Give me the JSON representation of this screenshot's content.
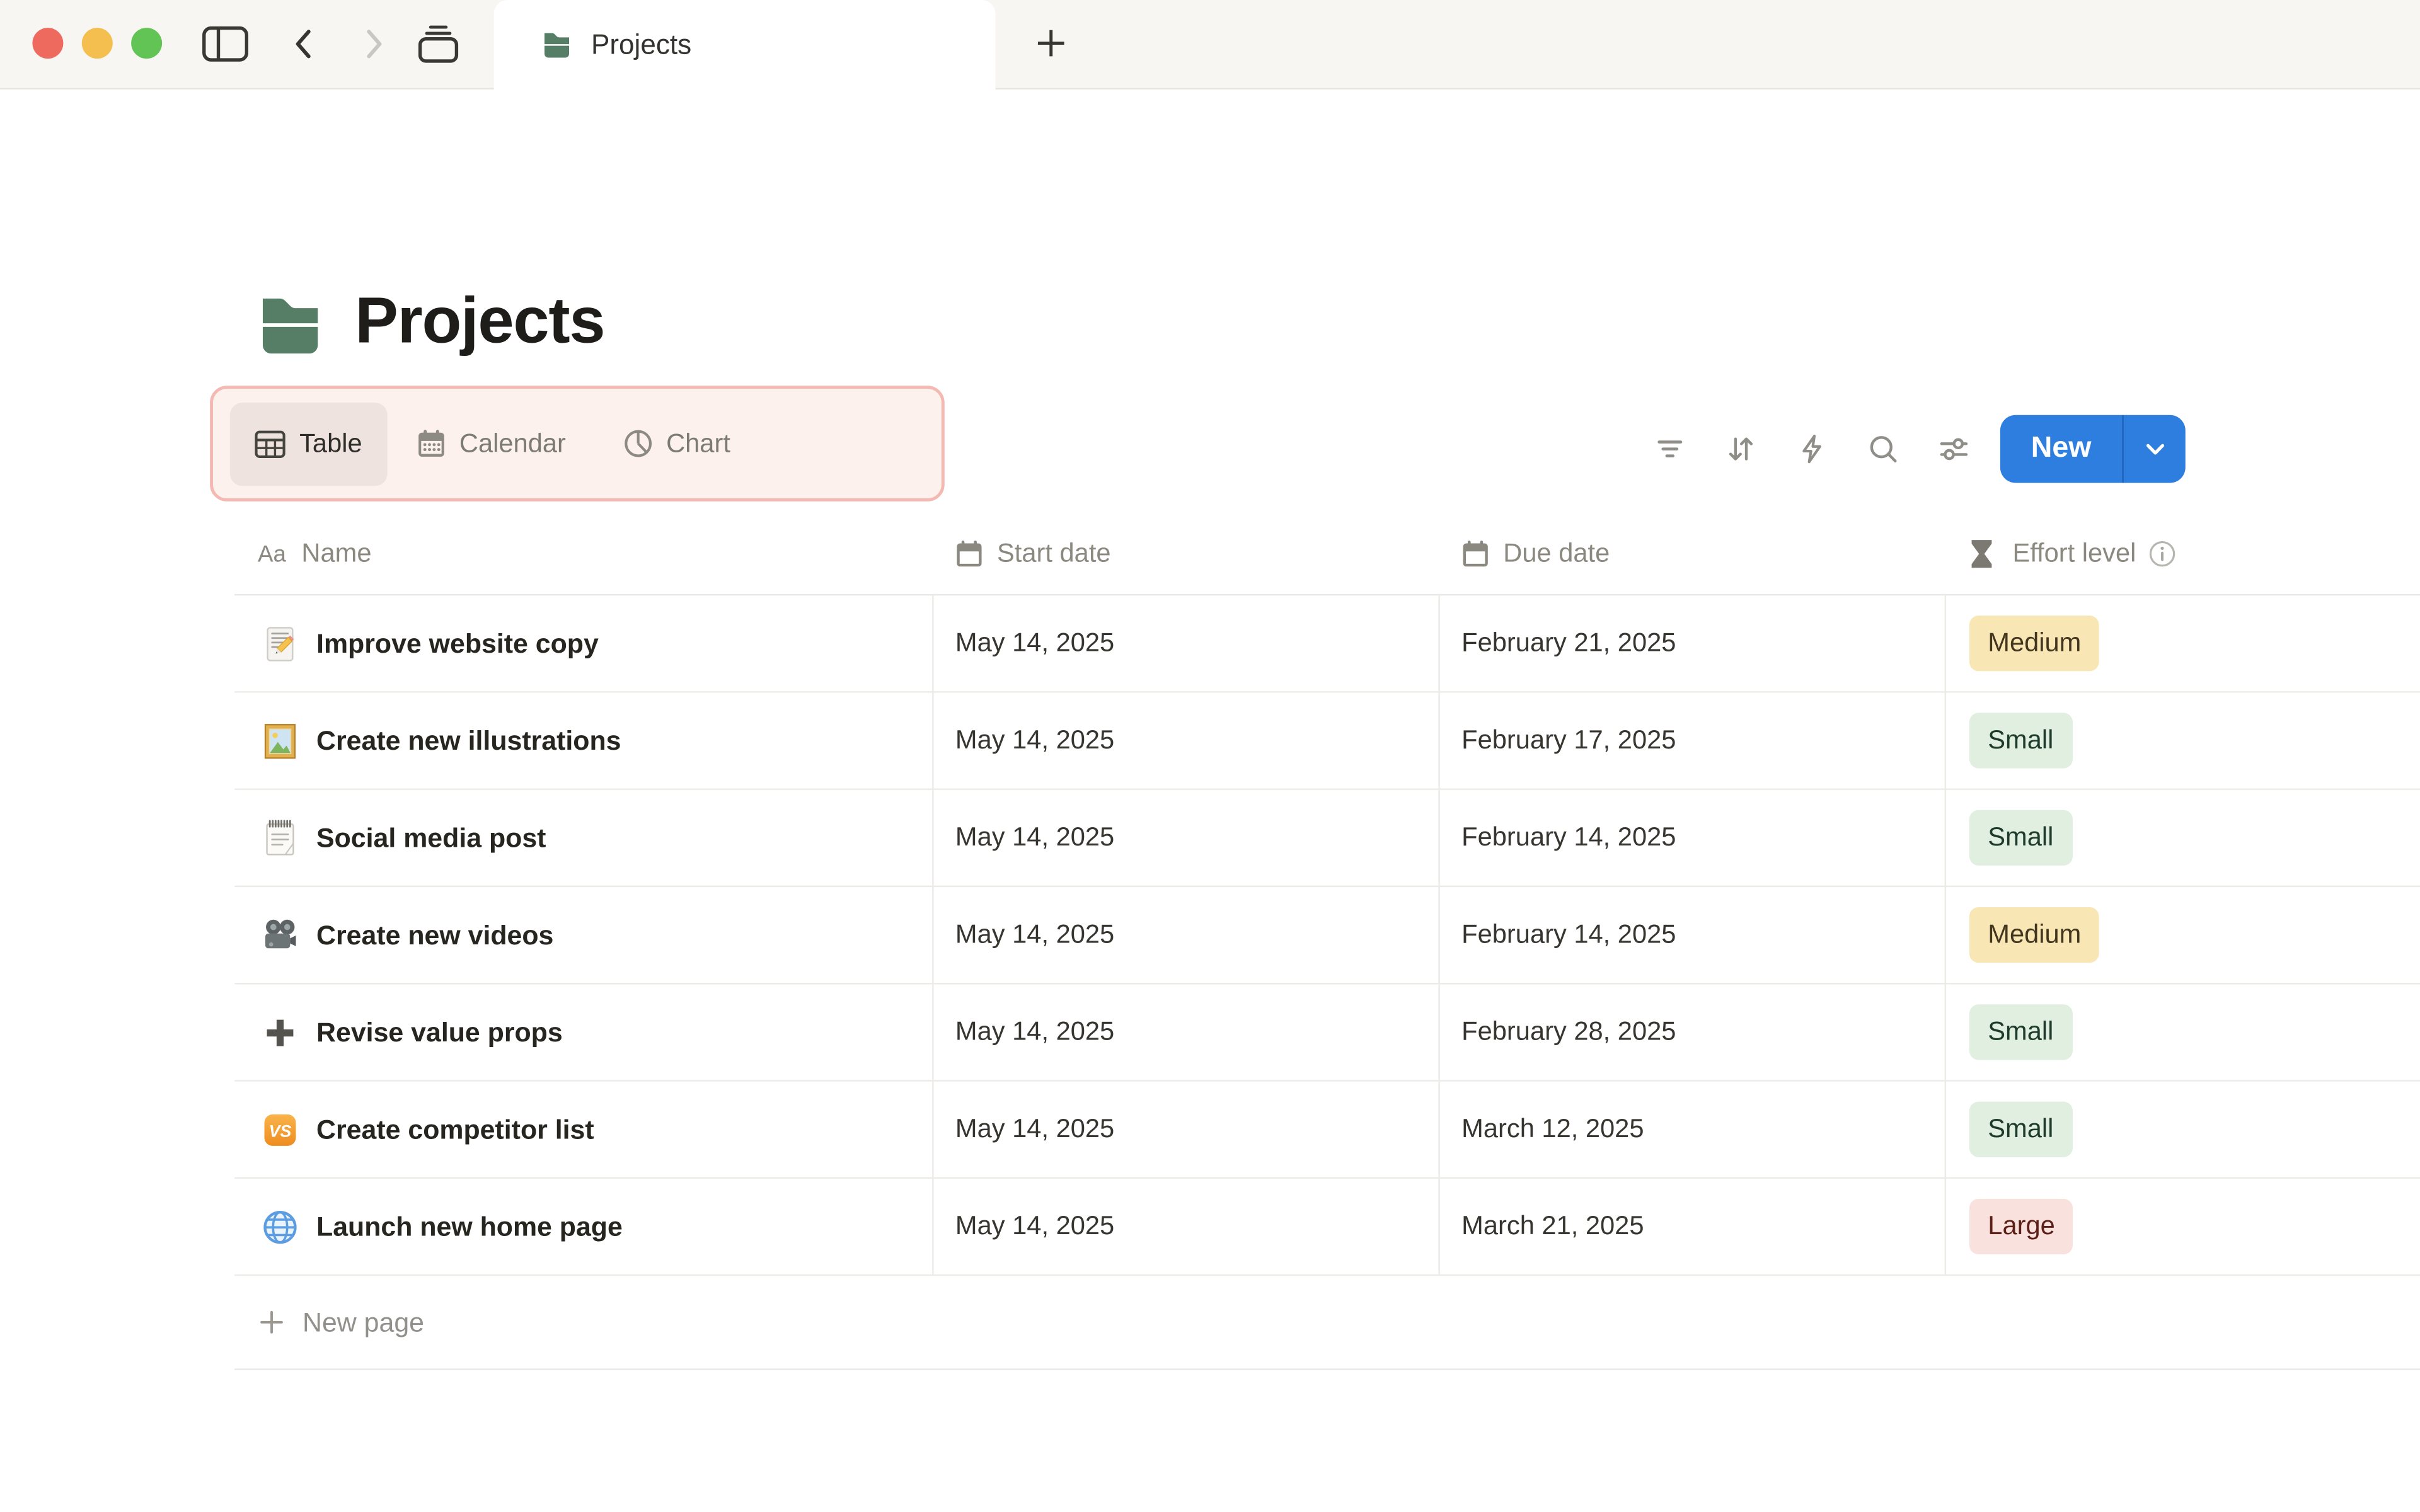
{
  "titlebar": {
    "tab_title": "Projects"
  },
  "page": {
    "icon": "green-folder",
    "title": "Projects"
  },
  "view_switcher": {
    "tabs": [
      {
        "label": "Table",
        "icon": "table-icon",
        "active": true
      },
      {
        "label": "Calendar",
        "icon": "calendar-icon",
        "active": false
      },
      {
        "label": "Chart",
        "icon": "pie-chart-icon",
        "active": false
      }
    ],
    "highlight_border": "#f4b9b2",
    "highlight_bg": "#fdf1ee"
  },
  "toolbar": {
    "icons": [
      "filter-icon",
      "sort-icon",
      "automations-icon",
      "search-icon",
      "customize-icon"
    ],
    "new_button": {
      "label": "New",
      "color": "#2e7ee0"
    }
  },
  "table": {
    "columns": [
      {
        "label": "Name",
        "icon": "text-icon",
        "icon_glyph": "Aa"
      },
      {
        "label": "Start date",
        "icon": "calendar-icon"
      },
      {
        "label": "Due date",
        "icon": "calendar-icon"
      },
      {
        "label": "Effort level",
        "icon": "hourglass-icon",
        "has_info": true
      }
    ],
    "rows": [
      {
        "icon": "memo-emoji",
        "name": "Improve website copy",
        "start_date": "May 14, 2025",
        "due_date": "February 21, 2025",
        "effort": "Medium",
        "effort_color": "yellow"
      },
      {
        "icon": "framed-picture-emoji",
        "name": "Create new illustrations",
        "start_date": "May 14, 2025",
        "due_date": "February 17, 2025",
        "effort": "Small",
        "effort_color": "green"
      },
      {
        "icon": "spiral-notepad-emoji",
        "name": "Social media post",
        "start_date": "May 14, 2025",
        "due_date": "February 14, 2025",
        "effort": "Small",
        "effort_color": "green"
      },
      {
        "icon": "movie-camera-emoji",
        "name": "Create new videos",
        "start_date": "May 14, 2025",
        "due_date": "February 14, 2025",
        "effort": "Medium",
        "effort_color": "yellow"
      },
      {
        "icon": "plus-emoji",
        "name": "Revise value props",
        "start_date": "May 14, 2025",
        "due_date": "February 28, 2025",
        "effort": "Small",
        "effort_color": "green"
      },
      {
        "icon": "vs-emoji",
        "name": "Create competitor list",
        "start_date": "May 14, 2025",
        "due_date": "March 12, 2025",
        "effort": "Small",
        "effort_color": "green"
      },
      {
        "icon": "globe-emoji",
        "name": "Launch new home page",
        "start_date": "May 14, 2025",
        "due_date": "March 21, 2025",
        "effort": "Large",
        "effort_color": "red"
      }
    ],
    "new_page_label": "New page"
  },
  "colors": {
    "accent_blue": "#2e7ee0",
    "titlebar_bg": "#f7f6f3",
    "folder_green": "#567e66",
    "badge_yellow_bg": "#f8e7b5",
    "badge_green_bg": "#e1efe1",
    "badge_red_bg": "#f9e2dd",
    "row_divider": "#ecebe8"
  }
}
